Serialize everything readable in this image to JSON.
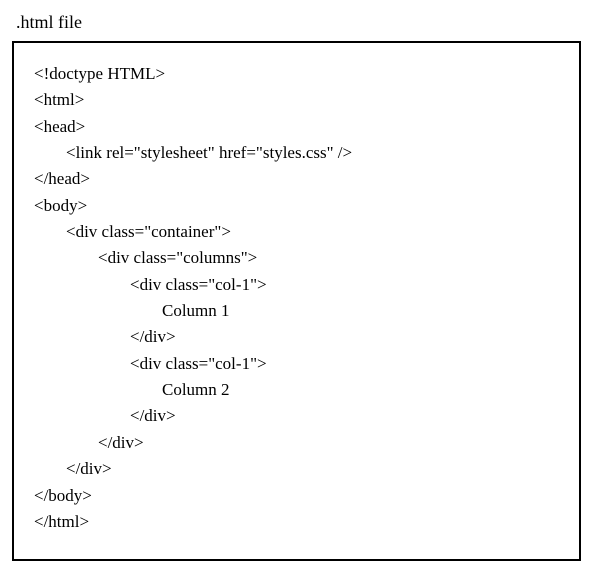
{
  "title": ".html file",
  "lines": [
    {
      "indent": 0,
      "text": "<!doctype HTML>"
    },
    {
      "indent": 0,
      "text": "<html>"
    },
    {
      "indent": 0,
      "text": "<head>"
    },
    {
      "indent": 1,
      "text": "<link rel=\"stylesheet\" href=\"styles.css\" />"
    },
    {
      "indent": 0,
      "text": "</head>"
    },
    {
      "indent": 0,
      "text": "<body>"
    },
    {
      "indent": 1,
      "text": "<div class=\"container\">"
    },
    {
      "indent": 2,
      "text": "<div class=\"columns\">"
    },
    {
      "indent": 3,
      "text": "<div class=\"col-1\">"
    },
    {
      "indent": 4,
      "text": "Column 1"
    },
    {
      "indent": 3,
      "text": "</div>"
    },
    {
      "indent": 3,
      "text": "<div class=\"col-1\">"
    },
    {
      "indent": 4,
      "text": "Column 2"
    },
    {
      "indent": 3,
      "text": "</div>"
    },
    {
      "indent": 2,
      "text": "</div>"
    },
    {
      "indent": 1,
      "text": "</div>"
    },
    {
      "indent": 0,
      "text": "</body>"
    },
    {
      "indent": 0,
      "text": "</html>"
    }
  ]
}
